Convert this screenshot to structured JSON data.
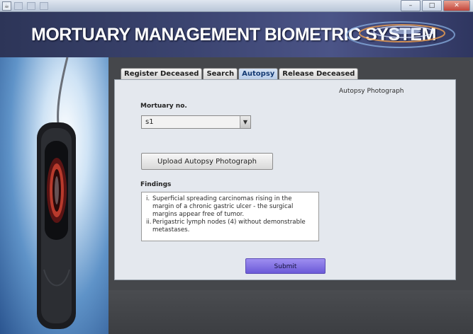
{
  "window": {
    "controls": {
      "minimize": "–",
      "maximize": "□",
      "close": "✕"
    }
  },
  "banner": {
    "title": "MORTUARY MANAGEMENT BIOMETRIC SYSTEM"
  },
  "tabs": [
    {
      "label": "Register Deceased",
      "active": false
    },
    {
      "label": "Search",
      "active": false
    },
    {
      "label": "Autopsy",
      "active": true
    },
    {
      "label": "Release Deceased",
      "active": false
    }
  ],
  "autopsy": {
    "photo_label": "Autopsy Photograph",
    "mortuary_label": "Mortuary no.",
    "mortuary_value": "s1",
    "upload_label": "Upload Autopsy Photograph",
    "findings_label": "Findings",
    "findings": [
      {
        "num": "i.",
        "text": "Superficial spreading carcinomas rising in the margin of a chronic gastric ulcer - the surgical margins appear free of tumor."
      },
      {
        "num": "ii.",
        "text": "Perigastric lymph nodes (4) without demonstrable metastases."
      }
    ],
    "submit_label": "Submit"
  },
  "colors": {
    "banner": "#3b4470",
    "submit": "#7b6be0",
    "panel": "#e4e8ee",
    "active_tab": "#b9cde8"
  },
  "icons": [
    "app-icon",
    "dropdown-arrow-icon",
    "fingerprint-scanner-image"
  ]
}
